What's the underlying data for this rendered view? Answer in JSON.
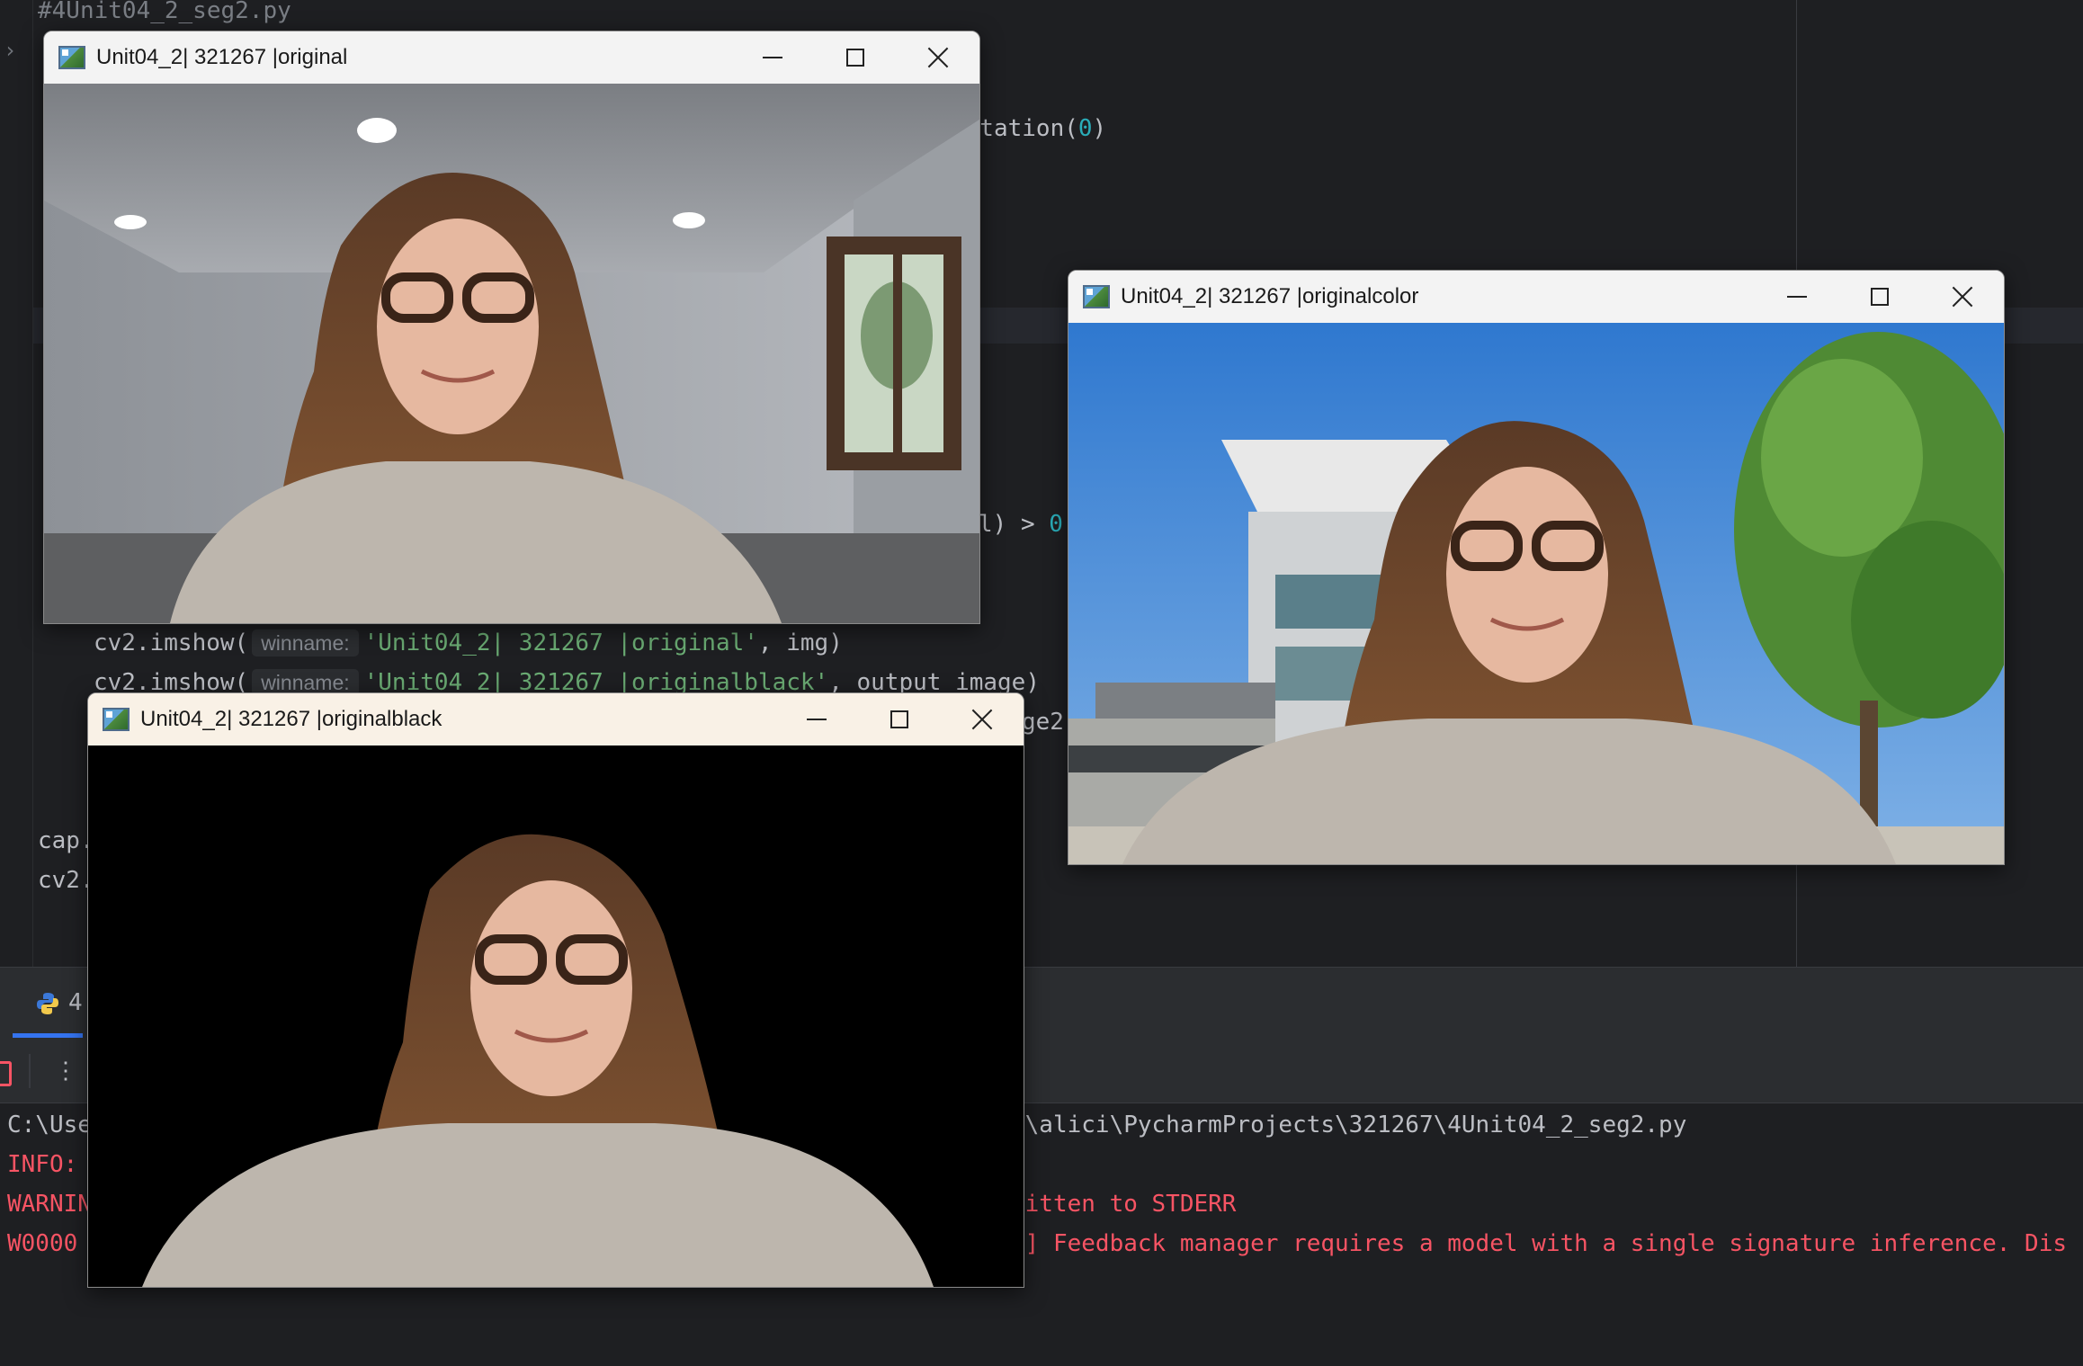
{
  "editor": {
    "filename_comment": "#4Unit04_2_seg2.py",
    "frag_entation": "entation(",
    "frag_zero": "0",
    "frag_gt": "l) > ",
    "frag_gt_num": "0.",
    "imshow1_call": "cv2.imshow(",
    "imshow1_hint": "winname:",
    "imshow1_str": "'Unit04_2| 321267 |original'",
    "imshow1_rest": ", img)",
    "imshow2_call": "cv2.imshow(",
    "imshow2_hint": "winname:",
    "imshow2_str": "'Unit04_2| 321267 |originalblack'",
    "imshow2_rest": ", output_image)",
    "frag_ge2": "ge2",
    "frag_cap": "cap.",
    "frag_cv2": "cv2."
  },
  "run_tab": {
    "label": "4"
  },
  "console": {
    "path_left": "C:\\Use",
    "path_right": "s\\alici\\PycharmProjects\\321267\\4Unit04_2_seg2.py",
    "info": "INFO:",
    "warning_left": "WARNIN",
    "warning_right": "ritten to STDERR",
    "w0000_left": "W0000",
    "w0000_right": "s] Feedback manager requires a model with a single signature inference. Dis"
  },
  "windows": {
    "original": {
      "title": "Unit04_2| 321267 |original"
    },
    "originalcolor": {
      "title": "Unit04_2| 321267 |originalcolor"
    },
    "originalblack": {
      "title": "Unit04_2| 321267 |originalblack"
    }
  },
  "colors": {
    "editor_bg": "#1e1f22",
    "string": "#6aab73",
    "number": "#2aacb8",
    "error_text": "#f75464",
    "sky": "#3d86d8"
  }
}
